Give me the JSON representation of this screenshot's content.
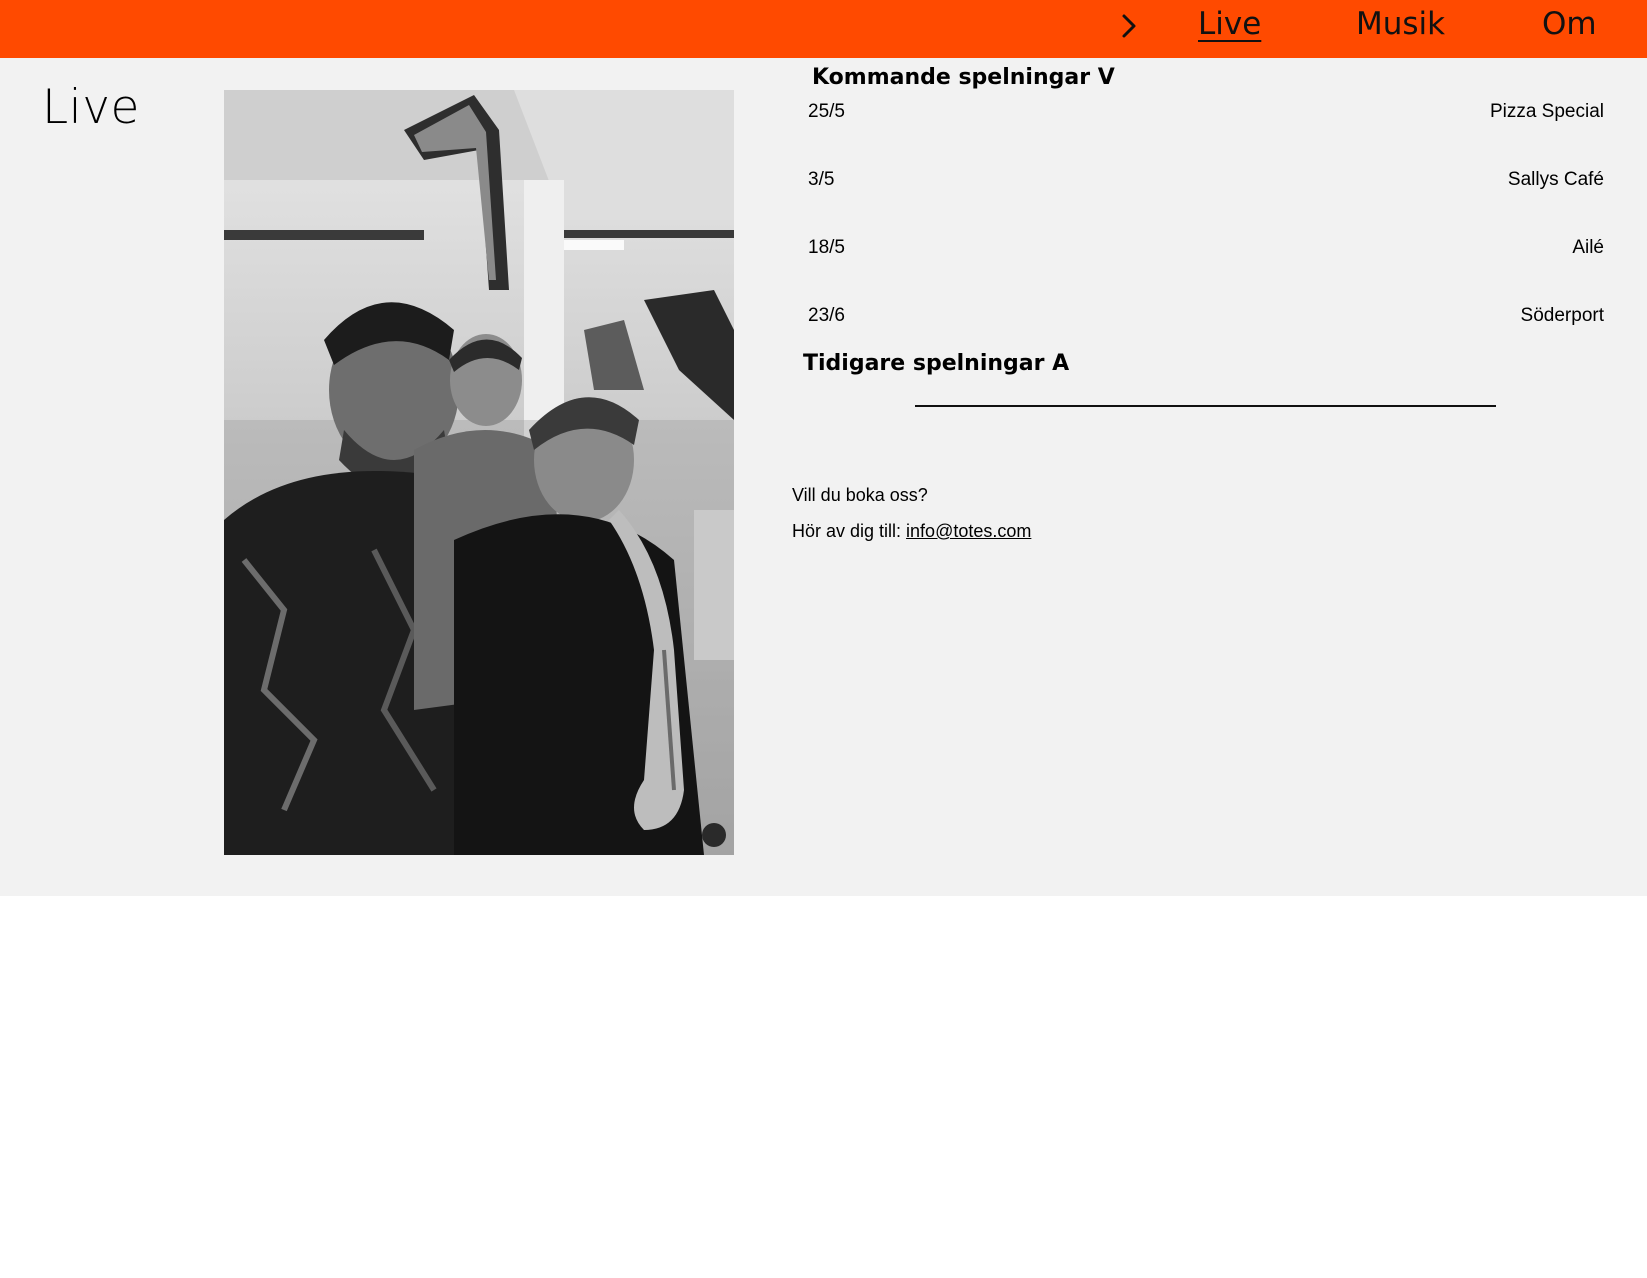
{
  "nav": {
    "items": [
      {
        "label": "Live",
        "active": true
      },
      {
        "label": "Musik",
        "active": false
      },
      {
        "label": "Om",
        "active": false
      }
    ],
    "chevron_icon": "chevron-right-icon",
    "background_color": "#ff4a00"
  },
  "page": {
    "title": "Live",
    "background_color": "#f2f2f2"
  },
  "photo": {
    "description_icon": "band-photo"
  },
  "upcoming": {
    "heading": "Kommande spelningar V",
    "gigs": [
      {
        "date": "25/5",
        "venue": "Pizza Special"
      },
      {
        "date": "3/5",
        "venue": "Sallys Café"
      },
      {
        "date": "18/5",
        "venue": "Ailé"
      },
      {
        "date": "23/6",
        "venue": "Söderport"
      }
    ]
  },
  "past": {
    "heading": "Tidigare spelningar A"
  },
  "contact": {
    "question": "Vill du boka oss?",
    "prompt": "Hör av dig till: ",
    "email": "info@totes.com"
  }
}
